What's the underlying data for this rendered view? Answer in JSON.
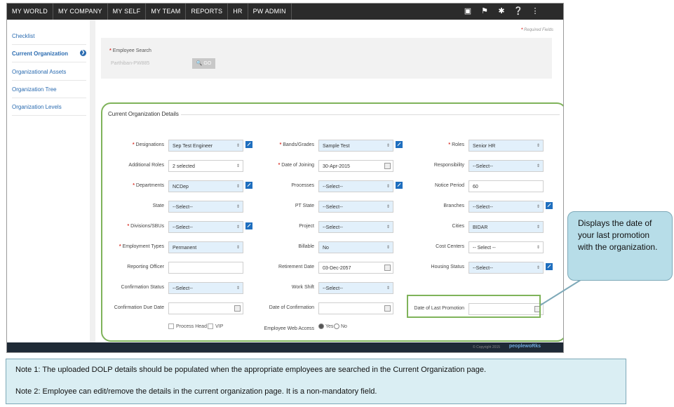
{
  "nav": {
    "items": [
      "MY WORLD",
      "MY COMPANY",
      "MY SELF",
      "MY TEAM",
      "REPORTS",
      "HR",
      "PW ADMIN"
    ],
    "icons": [
      "book-icon",
      "flag-icon",
      "tools-icon",
      "help-icon",
      "share-icon"
    ]
  },
  "sidebar": {
    "items": [
      "Checklist",
      "Current Organization",
      "Organizational Assets",
      "Organization Tree",
      "Organization Levels"
    ]
  },
  "required_note": "Required Fields",
  "search": {
    "label": "Employee Search",
    "value": "Parthiban-PW885",
    "go_label": "GO"
  },
  "section_title": "Current Organization Details",
  "fields": {
    "designations": {
      "label": "Designations",
      "value": "Sep Test Engineer"
    },
    "bands": {
      "label": "Bands/Grades",
      "value": "Sample Test"
    },
    "roles": {
      "label": "Roles",
      "value": "Senior HR"
    },
    "additional_roles": {
      "label": "Additional Roles",
      "value": "2 selected"
    },
    "doj": {
      "label": "Date of Joining",
      "value": "30-Apr-2015"
    },
    "responsibility": {
      "label": "Responsibility",
      "value": "--Select--"
    },
    "departments": {
      "label": "Departments",
      "value": "NCDep"
    },
    "processes": {
      "label": "Processes",
      "value": "--Select--"
    },
    "notice_period": {
      "label": "Notice Period",
      "value": "60"
    },
    "state": {
      "label": "State",
      "value": "--Select--"
    },
    "pt_state": {
      "label": "PT State",
      "value": "--Select--"
    },
    "branches": {
      "label": "Branches",
      "value": "--Select--"
    },
    "divisions": {
      "label": "Divisions/SBUs",
      "value": "--Select--"
    },
    "project": {
      "label": "Project",
      "value": "--Select--"
    },
    "cities": {
      "label": "Cities",
      "value": "BIDAR"
    },
    "employment_types": {
      "label": "Employment Types",
      "value": "Permanent"
    },
    "billable": {
      "label": "Billable",
      "value": "No"
    },
    "cost_centers": {
      "label": "Cost Centers",
      "value": "-- Select --"
    },
    "reporting_officer": {
      "label": "Reporting Officer",
      "value": ""
    },
    "retirement_date": {
      "label": "Retirement Date",
      "value": "03-Dec-2057"
    },
    "housing_status": {
      "label": "Housing Status",
      "value": "--Select--"
    },
    "confirmation_status": {
      "label": "Confirmation Status",
      "value": "--Select--"
    },
    "work_shift": {
      "label": "Work Shift",
      "value": "--Select--"
    },
    "confirmation_due_date": {
      "label": "Confirmation Due Date",
      "value": ""
    },
    "date_of_confirmation": {
      "label": "Date of Confirmation",
      "value": ""
    },
    "date_last_promotion": {
      "label": "Date of Last Promotion",
      "value": ""
    }
  },
  "checks": {
    "process_head": "Process Head",
    "vip": "VIP"
  },
  "web_access": {
    "label": "Employee Web Access",
    "yes": "Yes",
    "no": "No"
  },
  "footer": {
    "copyright": "© Copyright 2015",
    "brand": "peoplewoRks"
  },
  "callout": "Displays the date of your last promotion with the organization.",
  "notes": [
    "Note 1: The uploaded DOLP details should be populated when the appropriate employees are searched in the Current Organization page.",
    "Note 2: Employee can edit/remove the details in the current organization page. It is a non-mandatory field."
  ],
  "colors": {
    "nav_bg": "#2b2b2b",
    "link": "#2a6bb0",
    "highlight": "#7fb35a",
    "callout_bg": "#b7dde8"
  }
}
